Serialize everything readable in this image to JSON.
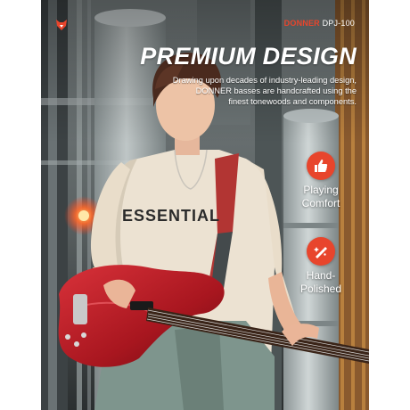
{
  "brand": {
    "name": "DONNER",
    "model": "DPJ-100",
    "logo_icon": "donner-fox-logo",
    "accent_color": "#e8452c"
  },
  "headline": "PREMIUM DESIGN",
  "description_lines": [
    "Drawing upon decades of industry-leading design,",
    "DONNER basses are handcrafted using the",
    "finest tonewoods and components."
  ],
  "shirt_text": "ESSENTIAL",
  "features": [
    {
      "icon": "thumbs-up-icon",
      "line1": "Playing",
      "line2": "Comfort"
    },
    {
      "icon": "hand-polish-icon",
      "line1": "Hand-",
      "line2": "Polished"
    }
  ]
}
